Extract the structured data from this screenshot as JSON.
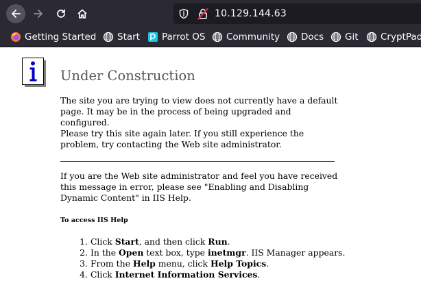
{
  "browser": {
    "url": "10.129.144.63",
    "bookmarks": [
      {
        "label": "Getting Started",
        "icon": "firefox-icon"
      },
      {
        "label": "Start",
        "icon": "globe-icon"
      },
      {
        "label": "Parrot OS",
        "icon": "parrot-icon"
      },
      {
        "label": "Community",
        "icon": "globe-icon"
      },
      {
        "label": "Docs",
        "icon": "globe-icon"
      },
      {
        "label": "Git",
        "icon": "globe-icon"
      },
      {
        "label": "CryptPad",
        "icon": "globe-icon"
      }
    ]
  },
  "page": {
    "title": "Under Construction",
    "para1": "The site you are trying to view does not currently have a default page. It may be in the process of being upgraded and configured.",
    "para2": "Please try this site again later. If you still experience the problem, try contacting the Web site administrator.",
    "para3": "If you are the Web site administrator and feel you have received this message in error, please see \"Enabling and Disabling Dynamic Content\" in IIS Help.",
    "help_heading": "To access IIS Help",
    "steps": [
      {
        "n": "1.",
        "a": "Click ",
        "b1": "Start",
        "c": ", and then click ",
        "b2": "Run",
        "d": "."
      },
      {
        "n": "2.",
        "a": "In the ",
        "b1": "Open",
        "c": " text box, type ",
        "b2": "inetmgr",
        "d": ". IIS Manager appears."
      },
      {
        "n": "3.",
        "a": "From the ",
        "b1": "Help",
        "c": " menu, click ",
        "b2": "Help Topics",
        "d": "."
      },
      {
        "n": "4.",
        "a": "Click ",
        "b1": "Internet Information Services",
        "c": "",
        "b2": "",
        "d": "."
      }
    ]
  },
  "colors": {
    "toolbar": "#2b2a33",
    "urlbar": "#1c1b22",
    "title": "#555555",
    "rule": "#1b1bba",
    "info_blue": "#0000cc"
  }
}
